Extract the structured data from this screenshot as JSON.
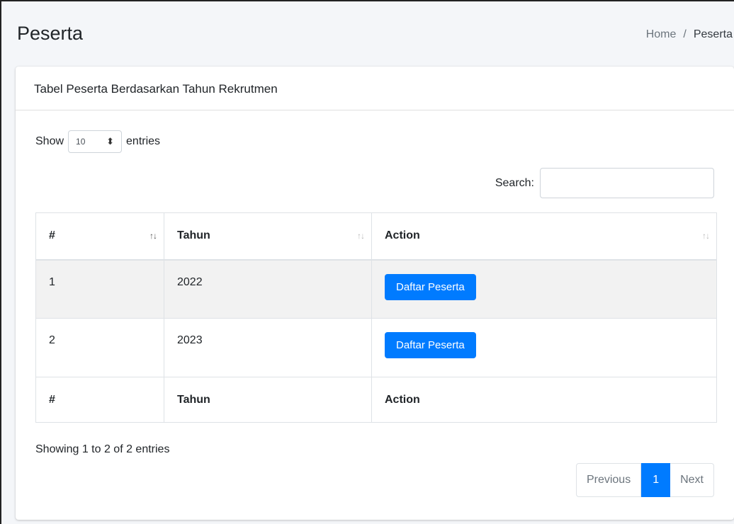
{
  "header": {
    "title": "Peserta",
    "breadcrumb": {
      "home": "Home",
      "separator": "/",
      "current": "Peserta"
    }
  },
  "card": {
    "title": "Tabel Peserta Berdasarkan Tahun Rekrutmen",
    "length": {
      "prefix": "Show",
      "value": "10",
      "suffix": "entries",
      "arrows_icon": "sort-arrows-icon"
    },
    "search": {
      "label": "Search:",
      "value": "",
      "placeholder": ""
    },
    "table": {
      "columns": [
        "#",
        "Tahun",
        "Action"
      ],
      "rows": [
        {
          "no": "1",
          "tahun": "2022",
          "action": "Daftar Peserta"
        },
        {
          "no": "2",
          "tahun": "2023",
          "action": "Daftar Peserta"
        }
      ],
      "footer": [
        "#",
        "Tahun",
        "Action"
      ]
    },
    "info": "Showing 1 to 2 of 2 entries",
    "pagination": {
      "previous": "Previous",
      "current": "1",
      "next": "Next"
    }
  },
  "colors": {
    "primary": "#007bff",
    "stripe": "#f2f2f2",
    "muted": "#6c757d"
  }
}
